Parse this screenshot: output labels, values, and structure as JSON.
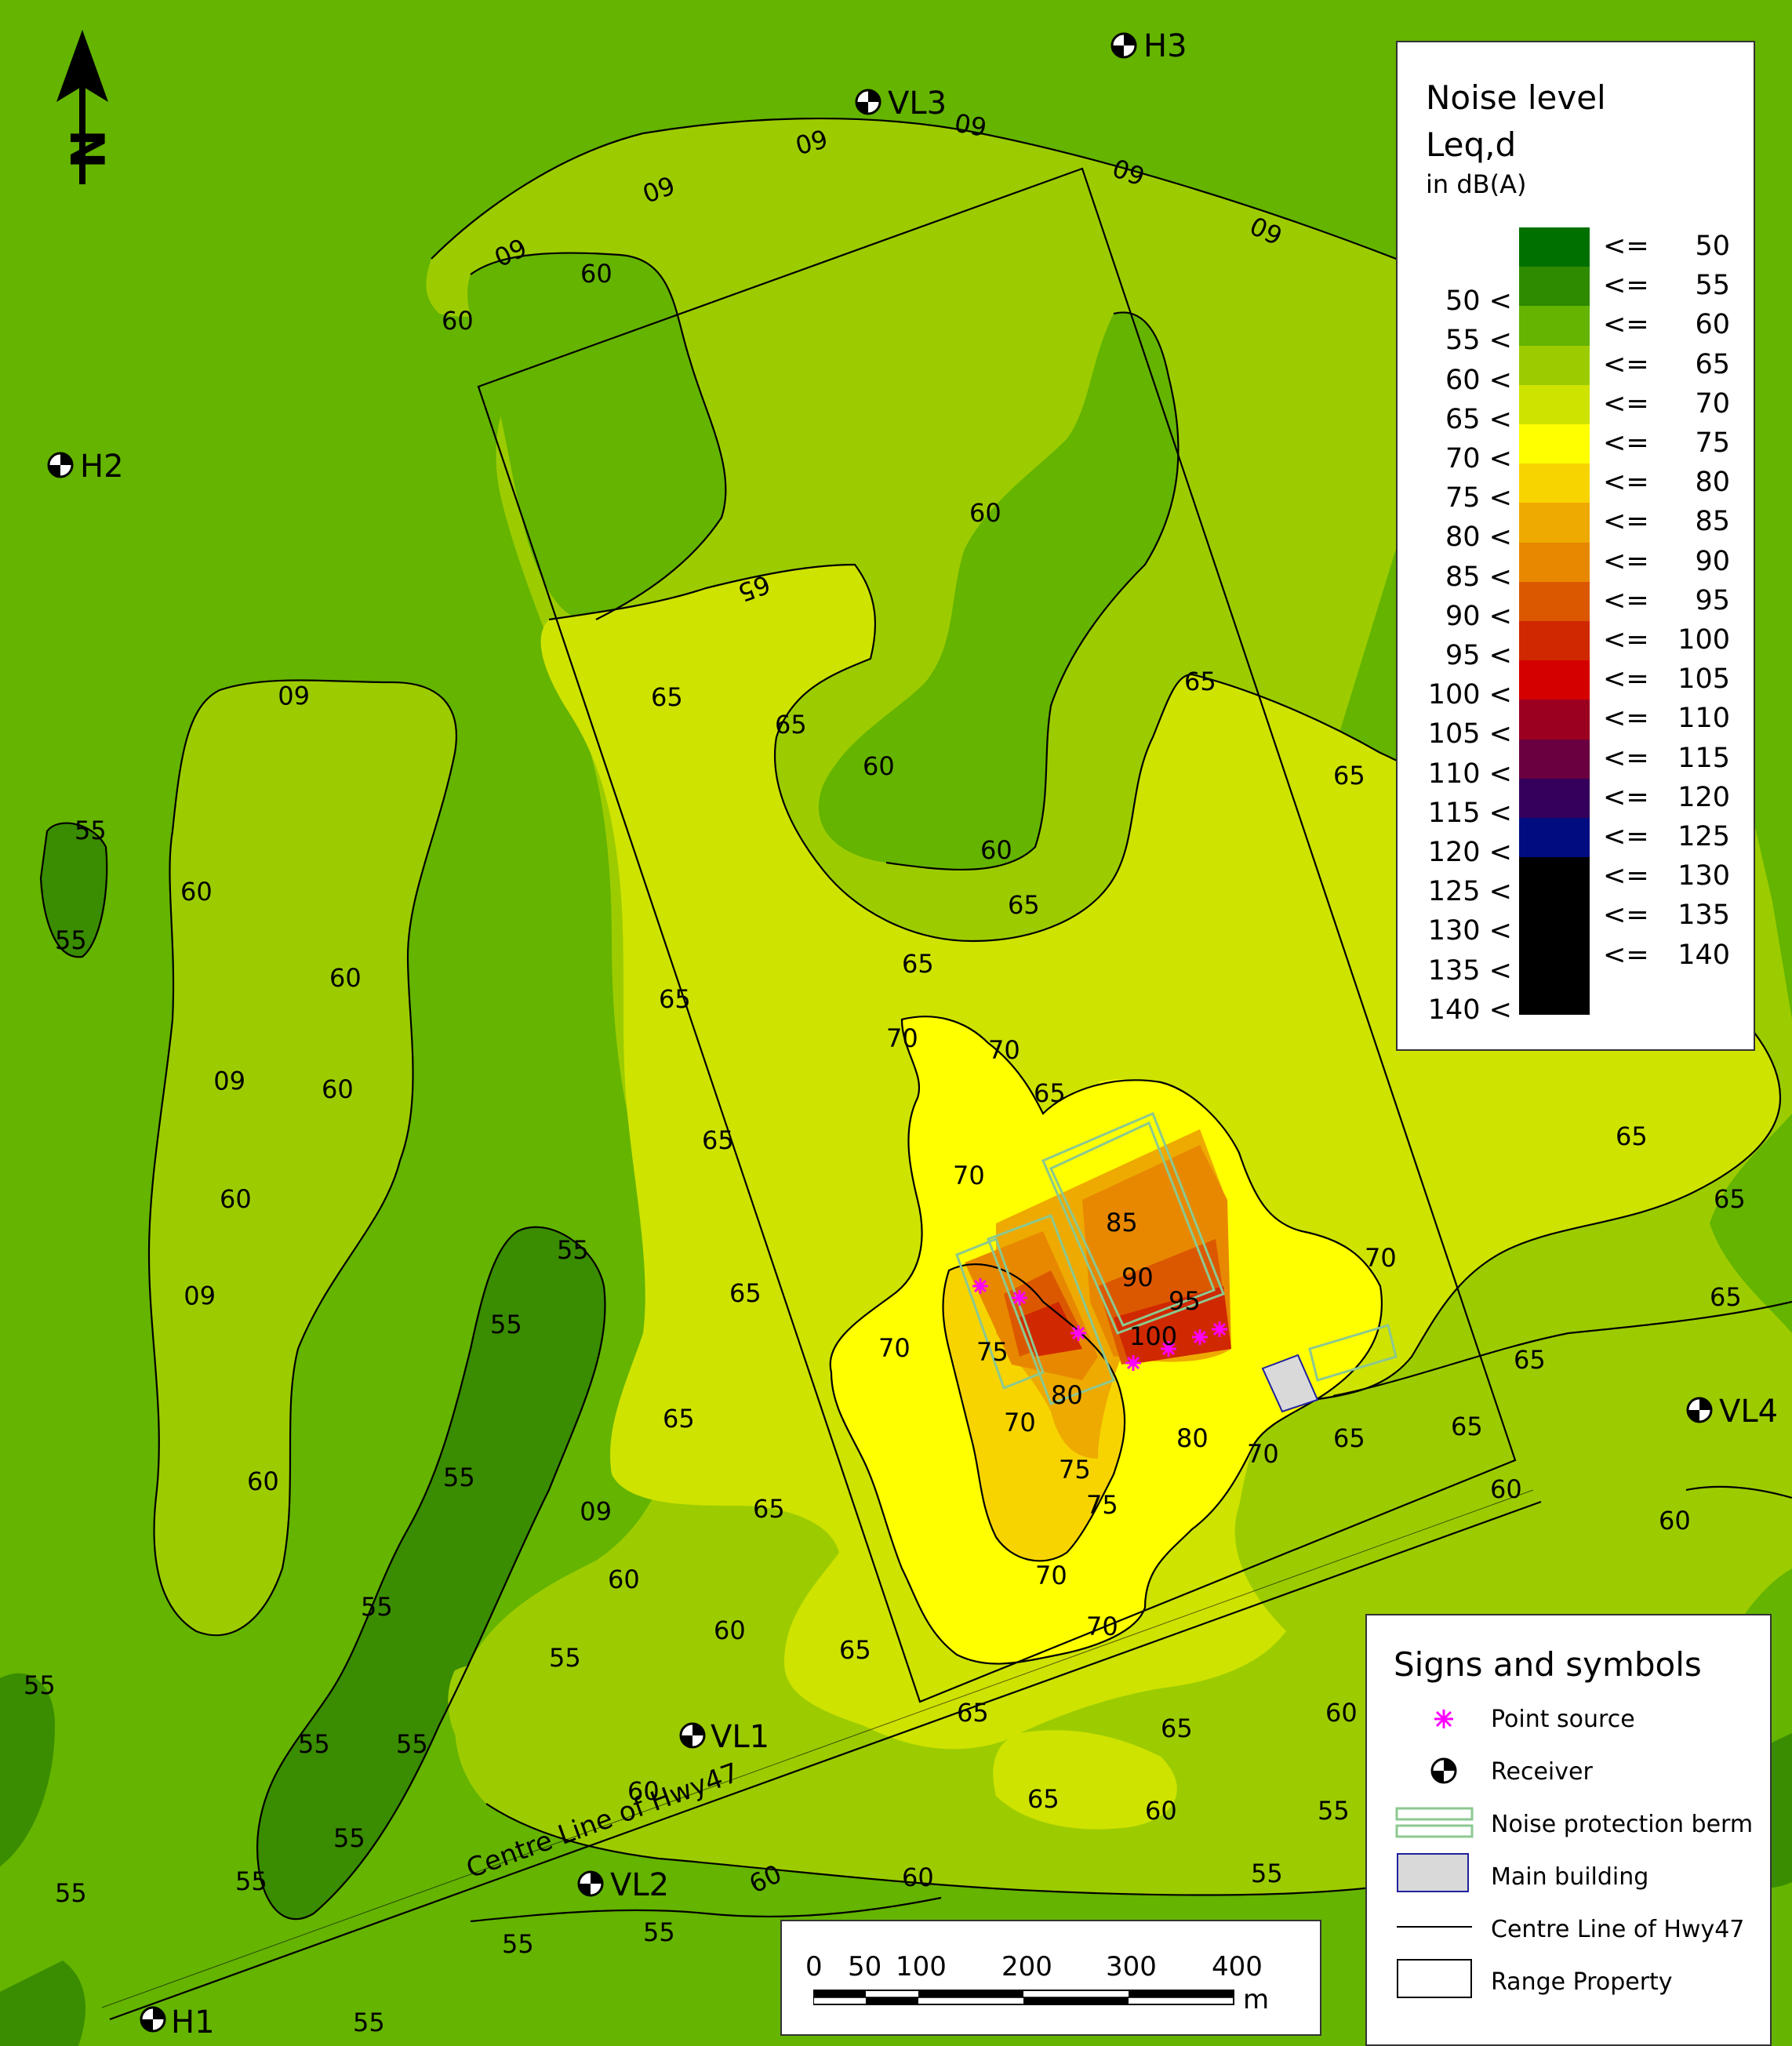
{
  "map": {
    "colors": {
      "le55": "#3a8c00",
      "le60": "#64b400",
      "le65": "#9ccc00",
      "le70": "#cee300",
      "le75": "#ffff00",
      "le80": "#f7d400",
      "le85": "#eeaa00",
      "le90": "#e88800",
      "le95": "#dc5800",
      "le100": "#d02800",
      "lines": "#000000",
      "berm": "#8cc890",
      "building": "#d9d9d9",
      "building_border": "#2020a0",
      "point_source": "#ff00ff"
    },
    "north_arrow_letter": "N",
    "receivers": {
      "H3": "H3",
      "VL3": "VL3",
      "H2": "H2",
      "VL4": "VL4",
      "VL1": "VL1",
      "VL2": "VL2",
      "H1": "H1"
    },
    "road_label": "Centre Line of Hwy47",
    "contour_labels": [
      "60",
      "65",
      "70",
      "75",
      "80",
      "85",
      "90",
      "95",
      "100",
      "55"
    ]
  },
  "noise_legend": {
    "title_line1": "Noise level",
    "title_line2": "Leq,d",
    "title_line3": "in dB(A)",
    "rows": [
      {
        "low": "",
        "high": "50",
        "color": "#007000"
      },
      {
        "low": "50",
        "high": "55",
        "color": "#2e8b00"
      },
      {
        "low": "55",
        "high": "60",
        "color": "#64b400"
      },
      {
        "low": "60",
        "high": "65",
        "color": "#9ccc00"
      },
      {
        "low": "65",
        "high": "70",
        "color": "#cee300"
      },
      {
        "low": "70",
        "high": "75",
        "color": "#ffff00"
      },
      {
        "low": "75",
        "high": "80",
        "color": "#f7d400"
      },
      {
        "low": "80",
        "high": "85",
        "color": "#eeaa00"
      },
      {
        "low": "85",
        "high": "90",
        "color": "#e88800"
      },
      {
        "low": "90",
        "high": "95",
        "color": "#dc5800"
      },
      {
        "low": "95",
        "high": "100",
        "color": "#d02800"
      },
      {
        "low": "100",
        "high": "105",
        "color": "#d40000"
      },
      {
        "low": "105",
        "high": "110",
        "color": "#9c0020"
      },
      {
        "low": "110",
        "high": "115",
        "color": "#6a0040"
      },
      {
        "low": "115",
        "high": "120",
        "color": "#34005c"
      },
      {
        "low": "120",
        "high": "125",
        "color": "#000c80"
      },
      {
        "low": "125",
        "high": "130",
        "color": "#000000"
      },
      {
        "low": "130",
        "high": "135",
        "color": "#000000"
      },
      {
        "low": "135",
        "high": "140",
        "color": "#000000"
      },
      {
        "low": "140",
        "high": "",
        "color": "#000000"
      }
    ],
    "lt": "<",
    "le": "<="
  },
  "symbols_legend": {
    "title": "Signs and symbols",
    "items": {
      "point_source": "Point source",
      "receiver": "Receiver",
      "berm": "Noise protection berm",
      "building": "Main building",
      "road": "Centre Line of Hwy47",
      "property": "Range Property"
    }
  },
  "scale_bar": {
    "ticks": [
      "0",
      "50",
      "100",
      "200",
      "300",
      "400"
    ],
    "unit": "m"
  }
}
